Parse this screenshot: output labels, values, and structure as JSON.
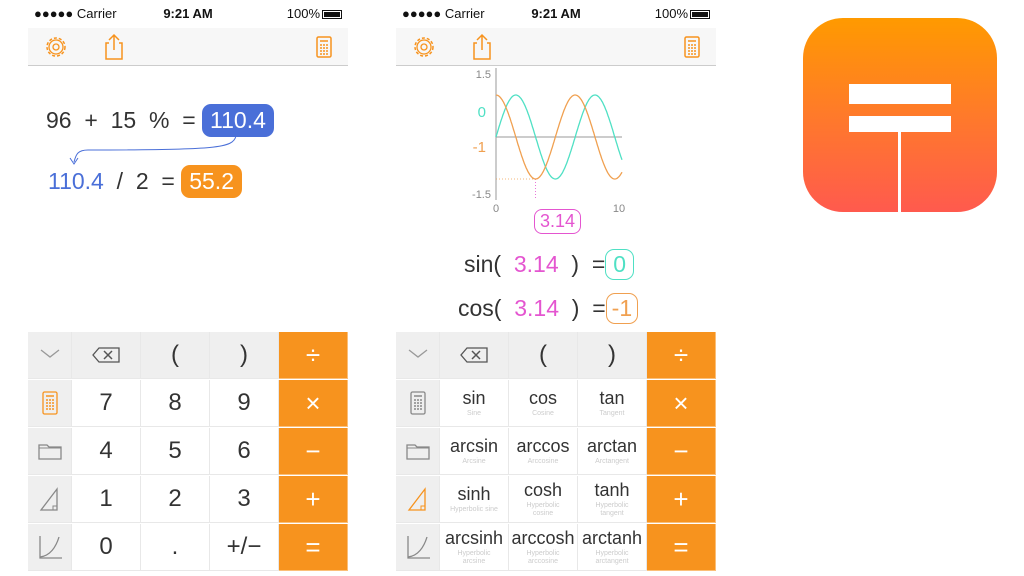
{
  "status": {
    "carrier": "●●●●● Carrier",
    "time": "9:21 AM",
    "battery": "100%"
  },
  "left": {
    "line1": {
      "a": "96",
      "op1": "+",
      "b": "15",
      "pct": "%",
      "eq": "=",
      "result": "110.4"
    },
    "line2": {
      "a": "110.4",
      "op": "/",
      "b": "2",
      "eq": "=",
      "result": "55.2"
    },
    "keys": [
      "(",
      ")",
      "÷",
      "7",
      "8",
      "9",
      "×",
      "4",
      "5",
      "6",
      "−",
      "1",
      "2",
      "3",
      "+",
      "0",
      ".",
      "+/−",
      "="
    ]
  },
  "right": {
    "graph": {
      "y_ticks": [
        "1.5",
        "0",
        "-1",
        "-1.5"
      ],
      "x_ticks": [
        "0",
        "10"
      ],
      "cursor": "3.14"
    },
    "sin": {
      "fn": "sin(",
      "arg": "3.14",
      "close": ")",
      "eq": "=",
      "result": "0"
    },
    "cos": {
      "fn": "cos(",
      "arg": "3.14",
      "close": ")",
      "eq": "=",
      "result": "-1"
    },
    "keys": {
      "paren_open": "(",
      "paren_close": ")",
      "div": "÷",
      "mul": "×",
      "minus": "−",
      "plus": "+",
      "eq": "="
    },
    "functions": [
      {
        "name": "sin",
        "desc": "Sine"
      },
      {
        "name": "cos",
        "desc": "Cosine"
      },
      {
        "name": "tan",
        "desc": "Tangent"
      },
      {
        "name": "arcsin",
        "desc": "Arcsine"
      },
      {
        "name": "arccos",
        "desc": "Arccosine"
      },
      {
        "name": "arctan",
        "desc": "Arctangent"
      },
      {
        "name": "sinh",
        "desc": "Hyperbolic sine"
      },
      {
        "name": "cosh",
        "desc": "Hyperbolic cosine"
      },
      {
        "name": "tanh",
        "desc": "Hyperbolic tangent"
      },
      {
        "name": "arcsinh",
        "desc": "Hyperbolic arcsine"
      },
      {
        "name": "arccosh",
        "desc": "Hyperbolic arccosine"
      },
      {
        "name": "arctanh",
        "desc": "Hyperbolic arctangent"
      }
    ]
  },
  "colors": {
    "accent": "#f7931e",
    "blue": "#4a6fd8",
    "sin": "#4fe0c4",
    "cos": "#f0a050",
    "cursor": "#e455d0"
  }
}
